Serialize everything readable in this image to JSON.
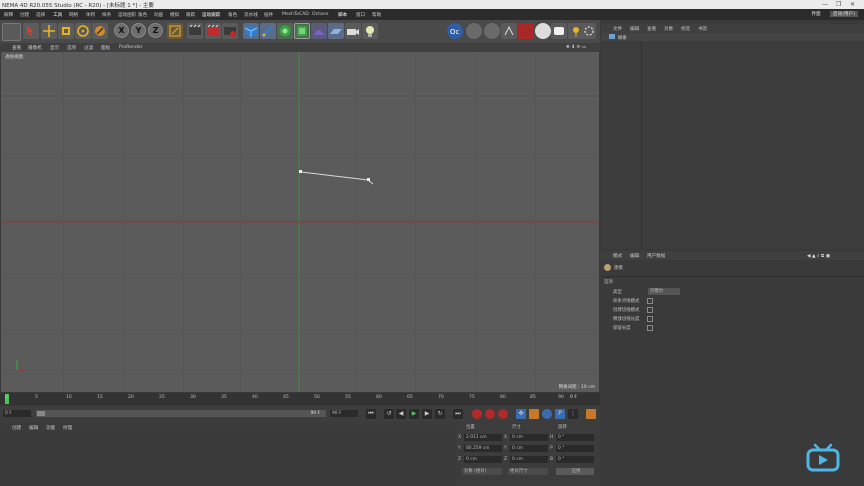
{
  "window": {
    "title": "NEMA 4D R20.055 Studio (RC - R20) - [未标题 1 *] - 主要",
    "controls": [
      "—",
      "❐",
      "✕"
    ]
  },
  "menubar": {
    "items": [
      "解释",
      "创建",
      "选择",
      "工具",
      "网格",
      "体积",
      "样条",
      "运动图形",
      "角色",
      "动画",
      "模拟",
      "跟踪",
      "运动跟踪",
      "角色",
      "流水线",
      "插件",
      "MeshToCAD",
      "Octane",
      "脚本",
      "窗口",
      "帮助"
    ],
    "right_label": "界面",
    "layout_value": "启动(用户)"
  },
  "toolbar": {
    "axis_x": "X",
    "axis_y": "Y",
    "axis_z": "Z"
  },
  "viewport_menu": {
    "items": [
      "查看",
      "摄像机",
      "显示",
      "选项",
      "过滤",
      "面板",
      "ProRender"
    ]
  },
  "viewport": {
    "label": "透视视图",
    "grid_spacing": "网格间距 : 10 cm"
  },
  "timeline": {
    "ticks": [
      "0",
      "5",
      "10",
      "15",
      "20",
      "25",
      "30",
      "35",
      "40",
      "45",
      "50",
      "55",
      "60",
      "65",
      "70",
      "75",
      "80",
      "85",
      "90"
    ],
    "current_frame": "0 F"
  },
  "playbar": {
    "start_frame": "0 F",
    "end_frame_field": "90 F",
    "end_frame": "90 F"
  },
  "material_menu": {
    "items": [
      "创建",
      "编辑",
      "功能",
      "纹理"
    ]
  },
  "coords": {
    "headers": [
      "位置",
      "尺寸",
      "旋转"
    ],
    "rows": [
      {
        "axis": "X",
        "pos": "2.011 cm",
        "size_axis": "X",
        "size": "0 cm",
        "rot_axis": "H",
        "rot": "0 °"
      },
      {
        "axis": "Y",
        "pos": "80.259 cm",
        "size_axis": "Y",
        "size": "0 cm",
        "rot_axis": "P",
        "rot": "0 °"
      },
      {
        "axis": "Z",
        "pos": "0 cm",
        "size_axis": "Z",
        "size": "0 cm",
        "rot_axis": "B",
        "rot": "0 °"
      }
    ],
    "mode": "对象 (相对)",
    "size_mode": "绝对尺寸",
    "apply_button": "应用"
  },
  "object_manager": {
    "menu": [
      "文件",
      "编辑",
      "查看",
      "对象",
      "标签",
      "书签"
    ],
    "tab_label": "样条"
  },
  "attribute_manager": {
    "menu": [
      "模式",
      "编辑",
      "用户数据"
    ],
    "object_label": "建模",
    "section": "选项",
    "fields": [
      {
        "label": "类型",
        "value": "贝塞尔"
      },
      {
        "label": "样条点线模式",
        "checked": false
      },
      {
        "label": "创建切线模式",
        "checked": false
      },
      {
        "label": "释放切线长度",
        "checked": false
      },
      {
        "label": "保留长度",
        "checked": false
      }
    ]
  },
  "colors": {
    "viewport_bg": "#5b5b5b",
    "grid_line": "#545454",
    "axis_y": "#3f8a3f",
    "axis_x": "#8a3a3a",
    "bilibili_blue": "#4fb7e8"
  }
}
